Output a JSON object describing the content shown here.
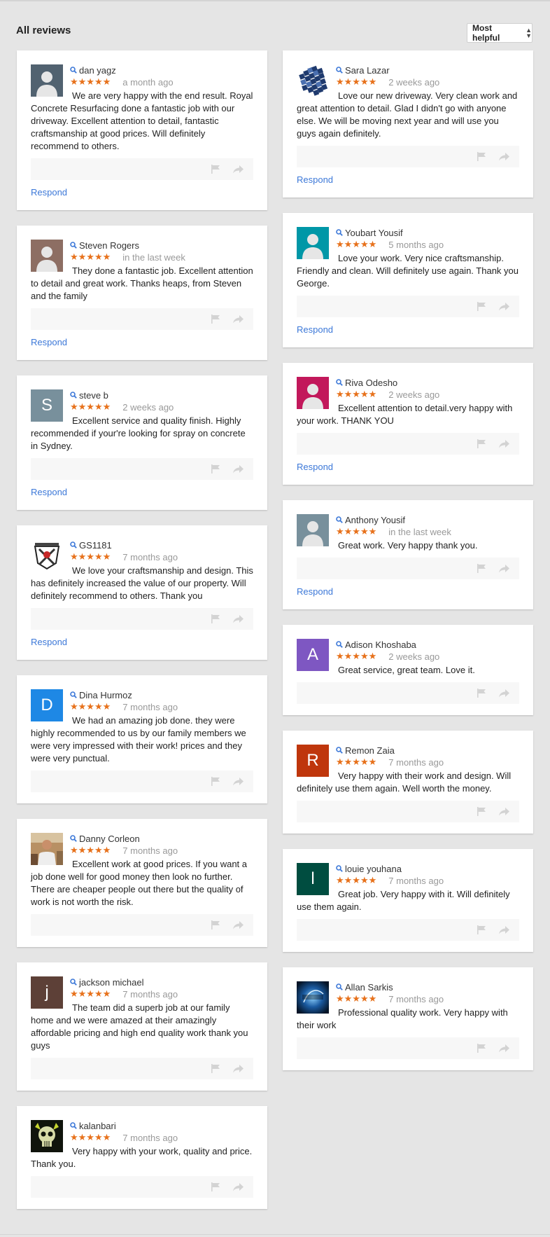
{
  "page": {
    "title": "All reviews",
    "sort_label": "Most helpful"
  },
  "colors": {
    "star": "#e7711b",
    "link": "#3c78d8",
    "background": "#e5e5e5"
  },
  "stars_text": "★★★★★",
  "left_reviews": [
    {
      "name": "dan yagz",
      "rating": 5,
      "date": "a month ago",
      "text": "We are very happy with the end result. Royal Concrete Resurfacing done a fantastic job with our driveway. Excellent attention to detail, fantastic craftsmanship at good prices. Will definitely recommend to others.",
      "respond": "Respond",
      "avatar": {
        "kind": "person",
        "bg": "#516270"
      }
    },
    {
      "name": "Steven Rogers",
      "rating": 5,
      "date": "in the last week",
      "text": "They done a fantastic job. Excellent attention to detail and great work. Thanks heaps, from Steven and the family",
      "respond": "Respond",
      "avatar": {
        "kind": "person",
        "bg": "#8d6e63"
      }
    },
    {
      "name": "steve b",
      "rating": 5,
      "date": "2 weeks ago",
      "text": "Excellent service and quality finish. Highly recommended if your're looking for spray on concrete in Sydney.",
      "respond": "Respond",
      "avatar": {
        "kind": "letter",
        "letter": "S",
        "bg": "#78909c"
      }
    },
    {
      "name": "GS1181",
      "rating": 5,
      "date": "7 months ago",
      "text": "We love your craftsmanship and design. This has definitely increased the value of our property. Will definitely recommend to others. Thank you",
      "respond": "Respond",
      "avatar": {
        "kind": "emblem",
        "bg": "#ffffff"
      }
    },
    {
      "name": "Dina Hurmoz",
      "rating": 5,
      "date": "7 months ago",
      "text": "We had an amazing job done. they were highly recommended to us by our family members we were very impressed with their work! prices and they were very punctual.",
      "respond": "",
      "avatar": {
        "kind": "letter",
        "letter": "D",
        "bg": "#1e88e5"
      }
    },
    {
      "name": "Danny Corleon",
      "rating": 5,
      "date": "7 months ago",
      "text": "Excellent work at good prices. If you want a job done well for good money then look no further. There are cheaper people out there but the quality of work is not worth the risk.",
      "respond": "",
      "avatar": {
        "kind": "photo",
        "bg": "#a07850"
      }
    },
    {
      "name": "jackson michael",
      "rating": 5,
      "date": "7 months ago",
      "text": "The team did a superb job at our family home and we were amazed at their amazingly affordable pricing and high end quality work thank you guys",
      "respond": "",
      "avatar": {
        "kind": "letter",
        "letter": "j",
        "bg": "#5d4037"
      }
    },
    {
      "name": "kalanbari",
      "rating": 5,
      "date": "7 months ago",
      "text": "Very happy with your work, quality and price. Thank you.",
      "respond": "",
      "avatar": {
        "kind": "skull",
        "bg": "#10140c"
      }
    }
  ],
  "right_reviews": [
    {
      "name": "Sara Lazar",
      "rating": 5,
      "date": "2 weeks ago",
      "text": "Love our new driveway. Very clean work and great attention to detail. Glad I didn't go with anyone else. We will be moving next year and will use you guys again definitely.",
      "respond": "Respond",
      "avatar": {
        "kind": "cube",
        "bg": "#ffffff"
      }
    },
    {
      "name": "Youbart Yousif",
      "rating": 5,
      "date": "5 months ago",
      "text": "Love your work. Very nice craftsmanship. Friendly and clean. Will definitely use again. Thank you George.",
      "respond": "Respond",
      "avatar": {
        "kind": "person",
        "bg": "#0097a7"
      }
    },
    {
      "name": "Riva Odesho",
      "rating": 5,
      "date": "2 weeks ago",
      "text": "Excellent attention to detail.very happy with your work. THANK YOU",
      "respond": "Respond",
      "avatar": {
        "kind": "person",
        "bg": "#c2185b"
      }
    },
    {
      "name": "Anthony Yousif",
      "rating": 5,
      "date": "in the last week",
      "text": "Great work. Very happy thank you.",
      "respond": "Respond",
      "avatar": {
        "kind": "person",
        "bg": "#78909c"
      }
    },
    {
      "name": "Adison Khoshaba",
      "rating": 5,
      "date": "2 weeks ago",
      "text": "Great service, great team. Love it.",
      "respond": "",
      "avatar": {
        "kind": "letter",
        "letter": "A",
        "bg": "#7e57c2"
      }
    },
    {
      "name": "Remon Zaia",
      "rating": 5,
      "date": "7 months ago",
      "text": "Very happy with their work and design. Will definitely use them again. Well worth the money.",
      "respond": "",
      "avatar": {
        "kind": "letter",
        "letter": "R",
        "bg": "#bf360c"
      }
    },
    {
      "name": "louie youhana",
      "rating": 5,
      "date": "7 months ago",
      "text": "Great job. Very happy with it. Will definitely use them again.",
      "respond": "",
      "avatar": {
        "kind": "letter",
        "letter": "l",
        "bg": "#004d40"
      }
    },
    {
      "name": "Allan Sarkis",
      "rating": 5,
      "date": "7 months ago",
      "text": "Professional quality work. Very happy with their work",
      "respond": "",
      "avatar": {
        "kind": "logo",
        "bg": "#0d2e5a"
      }
    }
  ]
}
